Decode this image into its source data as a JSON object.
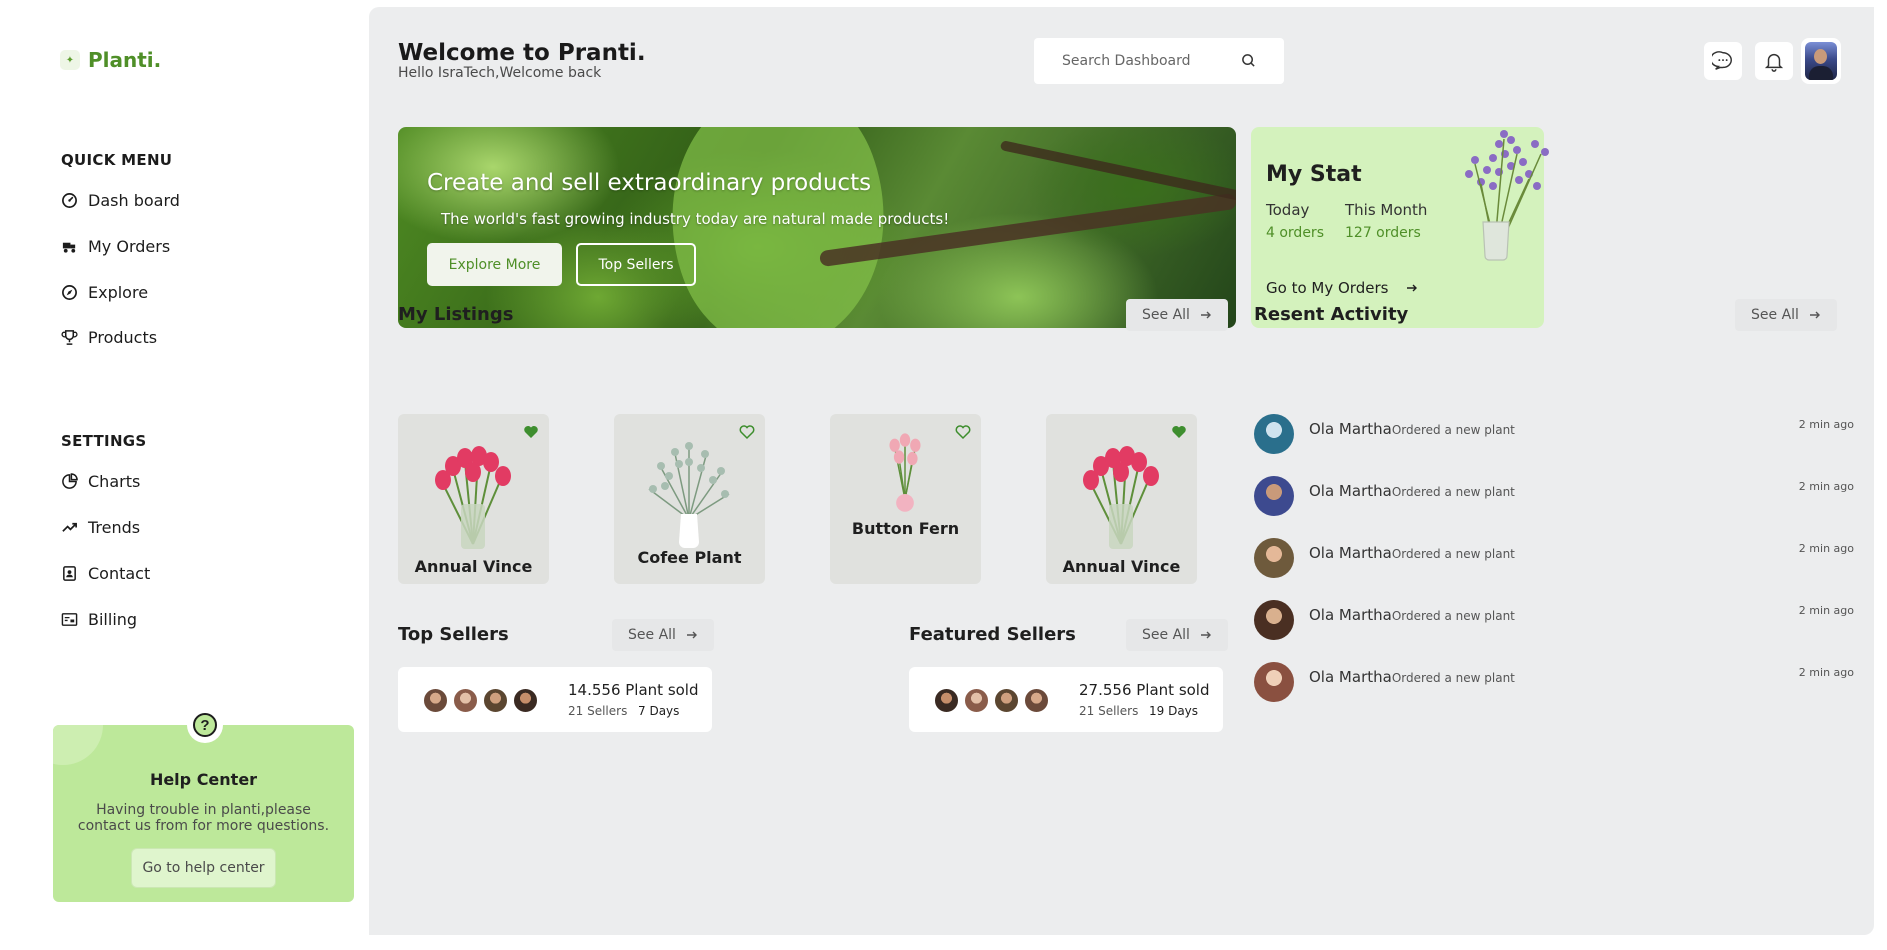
{
  "brand": {
    "name": "Planti."
  },
  "sidebar": {
    "quick_menu_title": "QUICK MENU",
    "quick_items": [
      {
        "label": "Dash board",
        "icon": "dashboard-icon"
      },
      {
        "label": "My Orders",
        "icon": "orders-icon"
      },
      {
        "label": "Explore",
        "icon": "compass-icon"
      },
      {
        "label": "Products",
        "icon": "trophy-icon"
      }
    ],
    "settings_title": "SETTINGS",
    "settings_items": [
      {
        "label": "Charts",
        "icon": "pie-chart-icon"
      },
      {
        "label": "Trends",
        "icon": "trend-icon"
      },
      {
        "label": "Contact",
        "icon": "contact-icon"
      },
      {
        "label": "Billing",
        "icon": "billing-icon"
      }
    ],
    "help": {
      "icon": "?",
      "title": "Help Center",
      "text": "Having trouble in planti,please contact us from for more questions.",
      "button": "Go to help center"
    }
  },
  "header": {
    "title": "Welcome to Pranti.",
    "subtitle": "Hello IsraTech,Welcome back",
    "search_placeholder": "Search Dashboard"
  },
  "hero": {
    "title": "Create and sell extraordinary products",
    "subtitle": "The world's fast growing industry today are natural made products!",
    "primary_button": "Explore More",
    "secondary_button": "Top Sellers"
  },
  "stat": {
    "title": "My Stat",
    "today_label": "Today",
    "today_value": "4 orders",
    "month_label": "This Month",
    "month_value": "127 orders",
    "link": "Go to My Orders"
  },
  "listings": {
    "title": "My Listings",
    "see_all": "See All",
    "items": [
      {
        "name": "Annual Vince",
        "kind": "tulips"
      },
      {
        "name": "Cofee Plant",
        "kind": "eucalyptus"
      },
      {
        "name": "Button Fern",
        "kind": "small-tulips"
      },
      {
        "name": "Annual Vince",
        "kind": "tulips"
      }
    ]
  },
  "top_sellers": {
    "title": "Top Sellers",
    "see_all": "See All",
    "sold": "14.556 Plant sold",
    "sellers": "21 Sellers",
    "days": "7 Days"
  },
  "featured_sellers": {
    "title": "Featured Sellers",
    "see_all": "See All",
    "sold": "27.556 Plant sold",
    "sellers": "21 Sellers",
    "days": "19 Days"
  },
  "activity": {
    "title": "Resent Activity",
    "see_all": "See All",
    "items": [
      {
        "name": "Ola Martha",
        "action": "Ordered a new plant",
        "time": "2 min ago"
      },
      {
        "name": "Ola Martha",
        "action": "Ordered a new plant",
        "time": "2 min ago"
      },
      {
        "name": "Ola Martha",
        "action": "Ordered a new plant",
        "time": "2 min ago"
      },
      {
        "name": "Ola Martha",
        "action": "Ordered a new plant",
        "time": "2 min ago"
      },
      {
        "name": "Ola Martha",
        "action": "Ordered a new plant",
        "time": "2 min ago"
      }
    ]
  },
  "colors": {
    "accent": "#4f8f28",
    "stat_bg": "#d4f2bd",
    "help_bg": "#bde89a",
    "panel_bg": "#ecedee"
  }
}
